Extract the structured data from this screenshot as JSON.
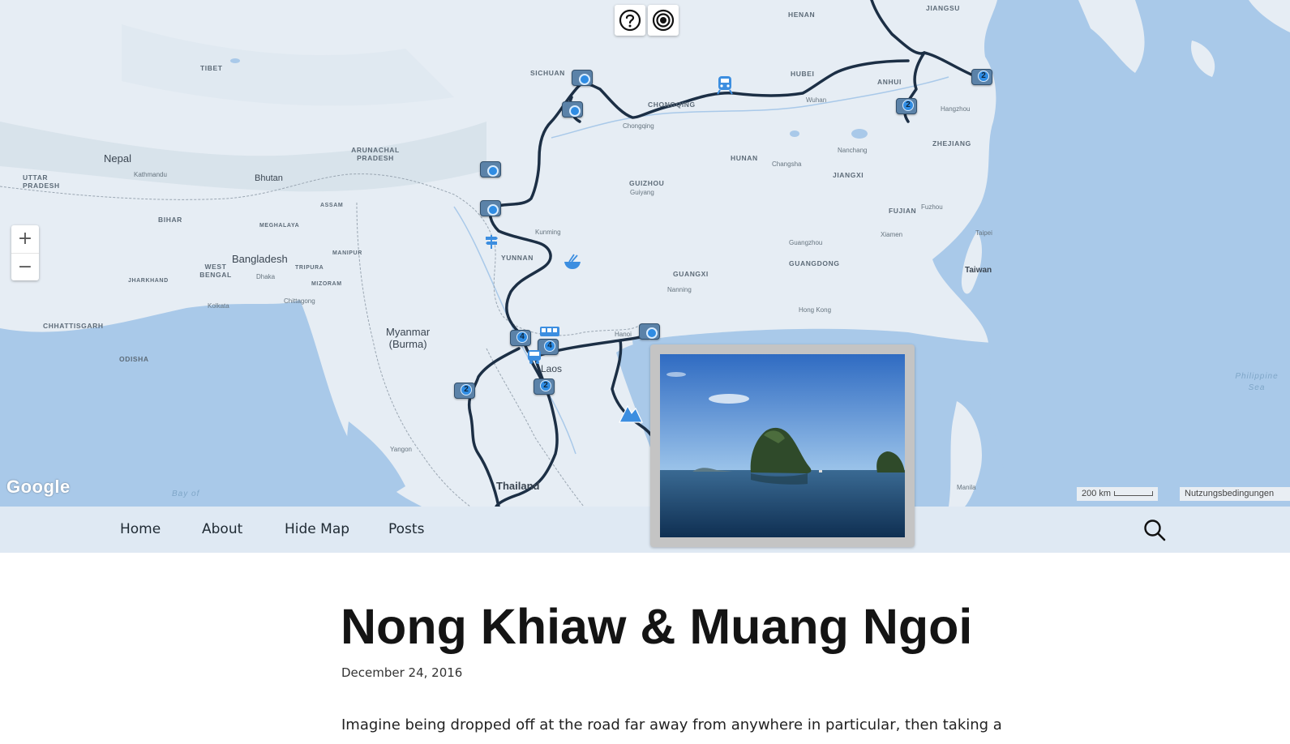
{
  "map": {
    "controls": {
      "help_icon": "help-circle-icon",
      "locate_icon": "target-icon",
      "zoom_in": "+",
      "zoom_out": "−"
    },
    "attribution": {
      "logo_text": "Google",
      "scale_text": "200 km",
      "terms_text": "Nutzungsbedingungen"
    },
    "labels": {
      "countries": [
        "Nepal",
        "Bhutan",
        "Bangladesh",
        "Myanmar\n(Burma)",
        "Thailand",
        "Laos",
        "Taiwan"
      ],
      "regions": [
        "TIBET",
        "SICHUAN",
        "CHONGQING",
        "HUBEI",
        "ANHUI",
        "JIANGSU",
        "HENAN",
        "ZHEJIANG",
        "JIANGXI",
        "HUNAN",
        "GUIZHOU",
        "YUNNAN",
        "GUANGXI",
        "GUANGDONG",
        "FUJIAN",
        "UTTAR PRADESH",
        "BIHAR",
        "ARUNACHAL PRADESH",
        "MEGHALAYA",
        "ASSAM",
        "WEST BENGAL",
        "JHARKHAND",
        "CHHATTISGARH",
        "ODISHA",
        "MANIPUR",
        "MIZORAM",
        "TRIPURA"
      ],
      "cities": [
        "Kathmandu",
        "Chongqing",
        "Wuhan",
        "Hangzhou",
        "Nanchang",
        "Changsha",
        "Guiyang",
        "Kunming",
        "Nanning",
        "Dhaka",
        "Kolkata",
        "Chittagong",
        "Hanoi",
        "Yangon",
        "Hong Kong",
        "Fuzhou",
        "Taipei",
        "Manila",
        "Guangzhou",
        "Xiamen"
      ],
      "water": [
        "Philippine Sea",
        "Bay of"
      ]
    },
    "markers": {
      "cluster_counts": [
        "2",
        "2",
        "4",
        "4",
        "2",
        "2"
      ]
    }
  },
  "nav": {
    "items": [
      "Home",
      "About",
      "Hide Map",
      "Posts"
    ],
    "search_icon": "search-icon"
  },
  "photo_popup": {
    "description_icon": "photo-thumbnail"
  },
  "post": {
    "title": "Nong Khiaw & Muang Ngoi",
    "date": "December 24, 2016",
    "excerpt": "Imagine being dropped off at the road far away from anywhere in particular, then taking a"
  },
  "colors": {
    "sea": "#a9c9e9",
    "land": "#e4ecf3",
    "route": "#1c2f45",
    "nav_bg": "#dfe9f3",
    "marker_blue": "#2f8ce3"
  }
}
